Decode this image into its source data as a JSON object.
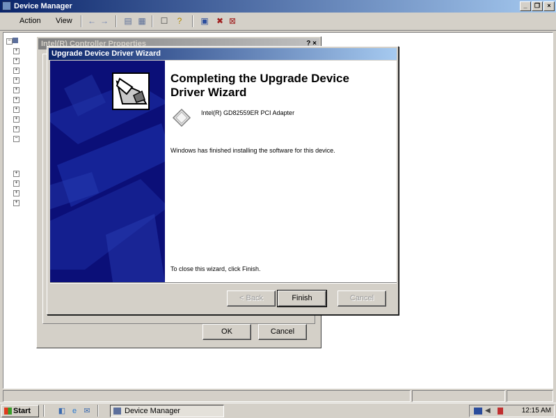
{
  "device_manager": {
    "title": "Device Manager",
    "menus": [
      "Action",
      "View"
    ],
    "toolbar_icons": [
      "back-icon",
      "forward-icon",
      "view-icon",
      "view-list-icon",
      "properties-icon",
      "help-icon",
      "scan-hardware-icon",
      "uninstall-icon",
      "disable-icon"
    ]
  },
  "properties_dialog": {
    "title": "Intel(R) Controller Properties",
    "caption_buttons": "? ×",
    "ok_label": "OK",
    "cancel_label": "Cancel"
  },
  "wizard": {
    "title": "Upgrade Device Driver Wizard",
    "heading": "Completing the Upgrade Device Driver Wizard",
    "device_name": "Intel(R) GD82559ER PCI Adapter",
    "finished_text": "Windows has finished installing the software for this device.",
    "close_text": "To close this wizard, click Finish.",
    "back_label": "< Back",
    "finish_label": "Finish",
    "cancel_label": "Cancel"
  },
  "taskbar": {
    "start_label": "Start",
    "task_label": "Device Manager",
    "clock": "12:15 AM"
  }
}
